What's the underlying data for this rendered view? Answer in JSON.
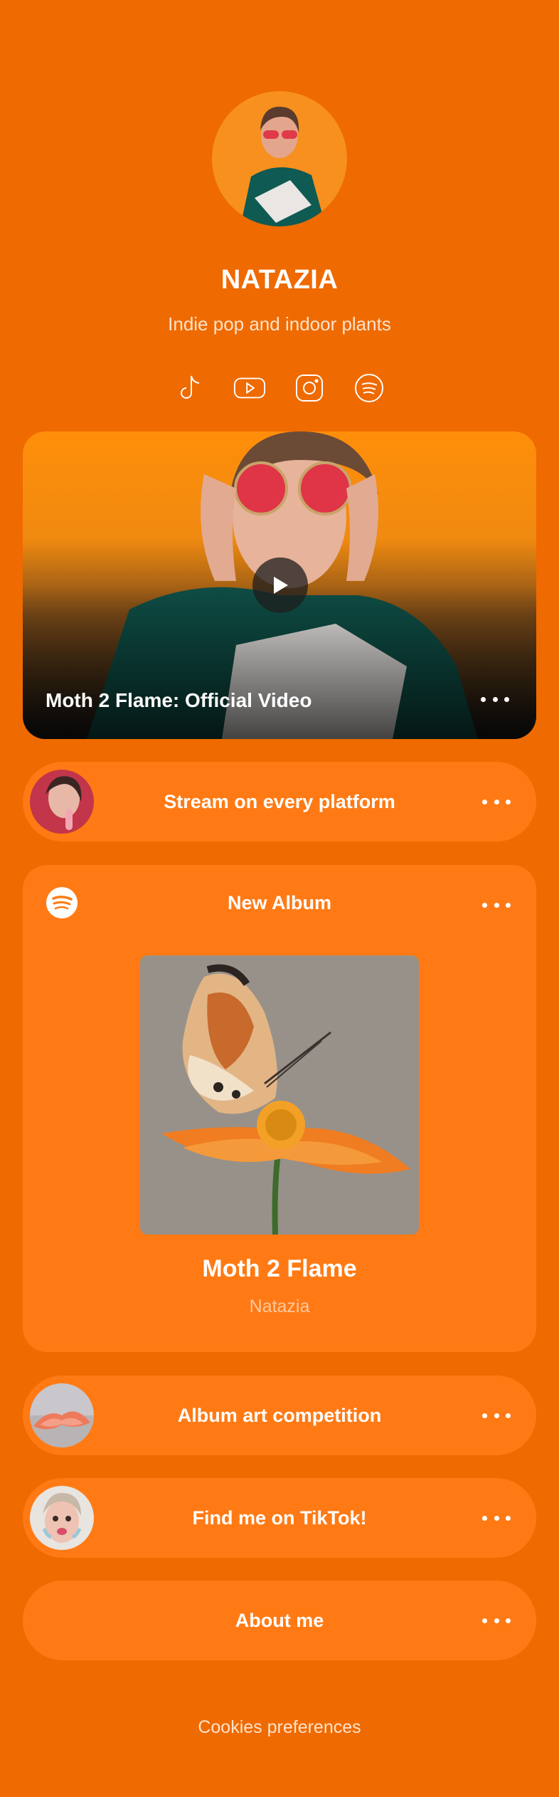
{
  "profile": {
    "name": "NATAZIA",
    "bio": "Indie pop and indoor plants"
  },
  "socials": [
    {
      "icon": "tiktok-icon"
    },
    {
      "icon": "youtube-icon"
    },
    {
      "icon": "instagram-icon"
    },
    {
      "icon": "spotify-icon"
    }
  ],
  "video": {
    "title": "Moth 2 Flame: Official Video"
  },
  "links": {
    "stream": "Stream on every platform",
    "competition": "Album art competition",
    "tiktok": "Find me on TikTok!",
    "about": "About me"
  },
  "album": {
    "header": "New Album",
    "title": "Moth 2 Flame",
    "artist": "Natazia"
  },
  "footer": {
    "cookies": "Cookies preferences"
  },
  "colors": {
    "background": "#EF6A00",
    "card": "#FF7A14",
    "text": "#FFFFFF"
  }
}
